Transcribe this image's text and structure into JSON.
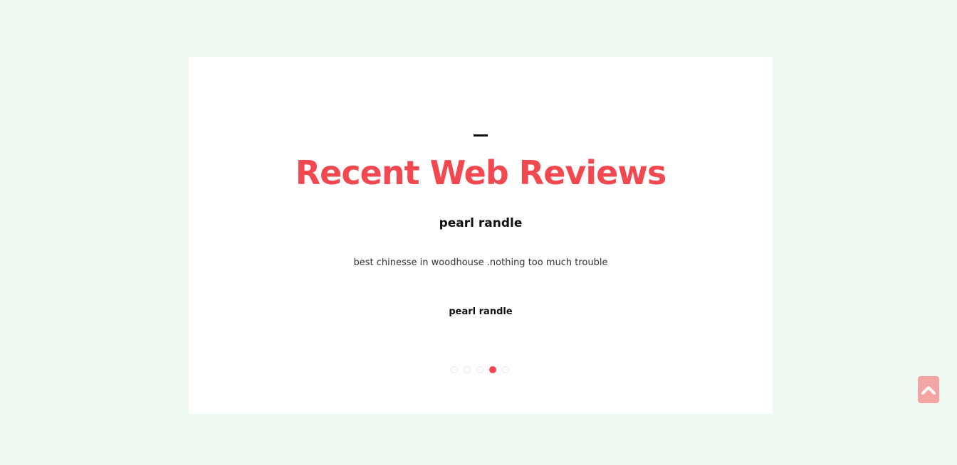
{
  "section": {
    "title": "Recent Web Reviews"
  },
  "review": {
    "reviewer_name": "pearl randle",
    "text": "best chinesse in woodhouse .nothing too much trouble",
    "author": "pearl randle"
  },
  "carousel": {
    "total_slides": 5,
    "active_index": 3
  },
  "icons": {
    "back_to_top": "chevron-up-icon"
  },
  "colors": {
    "page_background": "#edf9f1",
    "accent": "#f2484f",
    "back_to_top_button": "#f3a5a4"
  }
}
